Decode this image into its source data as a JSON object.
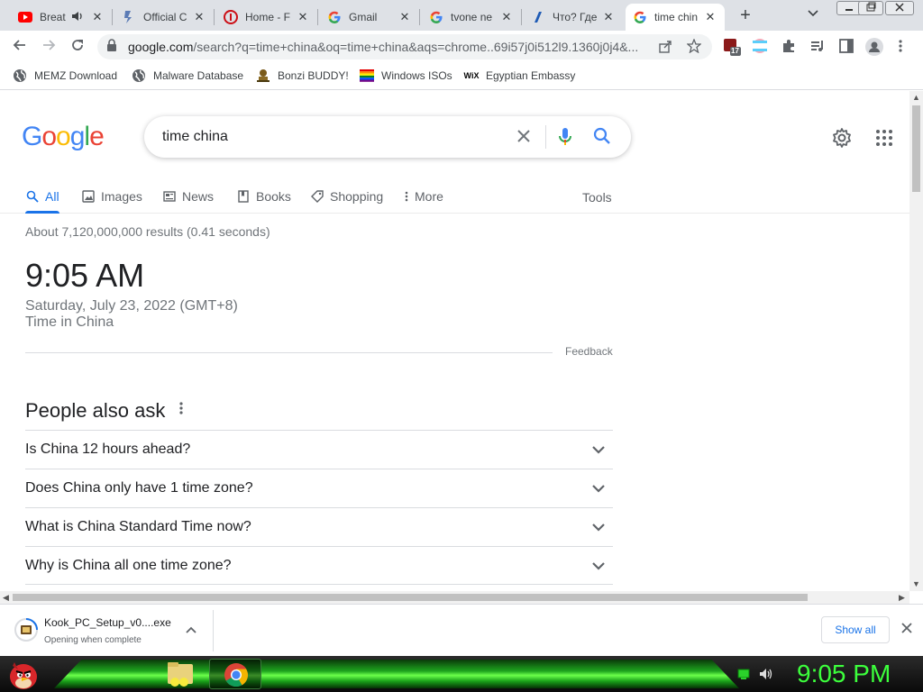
{
  "browser": {
    "tabs": [
      {
        "title": "Breat",
        "favicon": "youtube-icon",
        "audio": true
      },
      {
        "title": "Official C",
        "favicon": "site-icon"
      },
      {
        "title": "Home - F",
        "favicon": "opera-icon"
      },
      {
        "title": "Gmail",
        "favicon": "google-icon"
      },
      {
        "title": "tvone ne",
        "favicon": "google-icon"
      },
      {
        "title": "Что? Где",
        "favicon": "site-icon"
      },
      {
        "title": "time chin",
        "favicon": "google-icon",
        "active": true
      }
    ],
    "url_host": "google.com",
    "url_rest": "/search?q=time+china&oq=time+china&aqs=chrome..69i57j0i512l9.1360j0j4&...",
    "extension_badge": "17",
    "bookmarks": [
      {
        "label": "MEMZ Download",
        "icon": "globe-icon"
      },
      {
        "label": "Malware Database",
        "icon": "globe-icon"
      },
      {
        "label": "Bonzi BUDDY!",
        "icon": "bonzi-icon"
      },
      {
        "label": "Windows ISOs",
        "icon": "windows-flag-icon"
      },
      {
        "label": "Egyptian Embassy",
        "icon": "wix-icon"
      }
    ],
    "wix_text": "WiX"
  },
  "search": {
    "logo": [
      "G",
      "o",
      "o",
      "g",
      "l",
      "e"
    ],
    "query": "time china",
    "tabs": [
      "All",
      "Images",
      "News",
      "Books",
      "Shopping",
      "More"
    ],
    "tools": "Tools",
    "stats": "About 7,120,000,000 results (0.41 seconds)"
  },
  "time_card": {
    "time": "9:05 AM",
    "date": "Saturday, July 23, 2022 (GMT+8)",
    "location": "Time in China",
    "feedback": "Feedback"
  },
  "paa": {
    "title": "People also ask",
    "questions": [
      "Is China 12 hours ahead?",
      "Does China only have 1 time zone?",
      "What is China Standard Time now?",
      "Why is China all one time zone?"
    ]
  },
  "downloads": {
    "filename": "Kook_PC_Setup_v0....exe",
    "status": "Opening when complete",
    "show_all": "Show all"
  },
  "taskbar": {
    "clock": "9:05 PM"
  },
  "colors": {
    "google_blue": "#4285f4",
    "google_red": "#ea4335",
    "google_yellow": "#fbbc05",
    "google_green": "#34a853",
    "link_blue": "#1a73e8",
    "clock_green": "#3cff3c"
  }
}
